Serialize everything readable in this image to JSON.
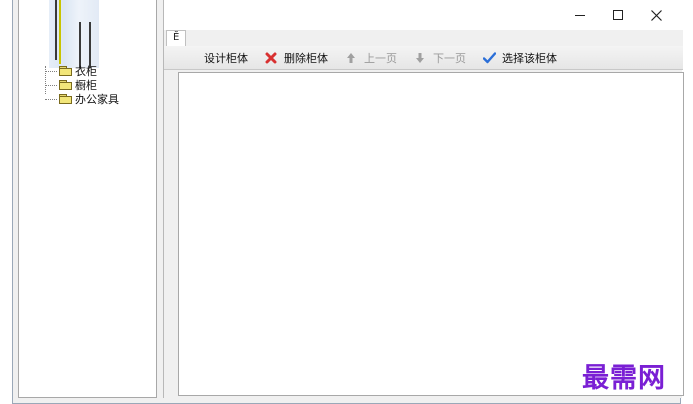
{
  "tree": {
    "items": [
      {
        "label": "衣柜",
        "icon": "folder-icon"
      },
      {
        "label": "橱柜",
        "icon": "folder-icon"
      },
      {
        "label": "办公家具",
        "icon": "folder-icon"
      }
    ]
  },
  "window": {
    "tab_label": "Ĕ"
  },
  "toolbar": {
    "design_label": "设计柜体",
    "delete_label": "删除柜体",
    "prev_label": "上一页",
    "next_label": "下一页",
    "select_label": "选择该柜体",
    "delete_icon_color": "#d83030",
    "select_icon_color": "#2b6fd8",
    "disabled_color": "#9a9a9a"
  },
  "watermark": {
    "text": "最需网",
    "color": "#7a1fd4"
  }
}
